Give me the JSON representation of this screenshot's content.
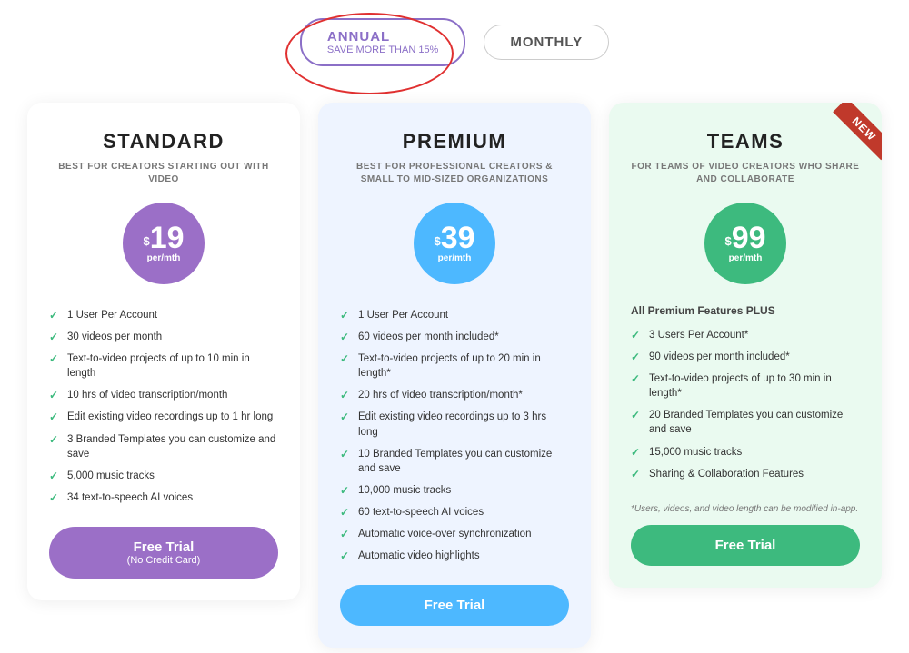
{
  "toggle": {
    "annual_label": "ANNUAL",
    "annual_sub": "SAVE MORE THAN 15%",
    "monthly_label": "MONTHLY"
  },
  "plans": [
    {
      "id": "standard",
      "title": "STANDARD",
      "subtitle": "BEST FOR CREATORS STARTING OUT WITH VIDEO",
      "price_symbol": "$",
      "price": "19",
      "price_unit": "per/mth",
      "circle_class": "purple",
      "features": [
        "1 User Per Account",
        "30 videos per month",
        "Text-to-video projects of up to 10 min in length",
        "10 hrs of video transcription/month",
        "Edit existing video recordings up to 1 hr long",
        "3 Branded Templates you can customize and save",
        "5,000 music tracks",
        "34 text-to-speech AI voices"
      ],
      "cta_label": "Free Trial",
      "cta_sub": "(No Credit Card)",
      "cta_class": "purple-btn",
      "is_new": false,
      "teams_intro": "",
      "teams_note": ""
    },
    {
      "id": "premium",
      "title": "PREMIUM",
      "subtitle": "BEST FOR PROFESSIONAL CREATORS & SMALL TO MID-SIZED ORGANIZATIONS",
      "price_symbol": "$",
      "price": "39",
      "price_unit": "per/mth",
      "circle_class": "blue",
      "features": [
        "1 User Per Account",
        "60 videos per month included*",
        "Text-to-video projects of up to 20 min in length*",
        "20 hrs of video transcription/month*",
        "Edit existing video recordings up to 3 hrs long",
        "10 Branded Templates you can customize and save",
        "10,000 music tracks",
        "60 text-to-speech AI voices",
        "Automatic voice-over synchronization",
        "Automatic video highlights"
      ],
      "cta_label": "Free Trial",
      "cta_sub": "",
      "cta_class": "blue-btn",
      "is_new": false,
      "teams_intro": "",
      "teams_note": ""
    },
    {
      "id": "teams",
      "title": "TEAMS",
      "subtitle": "FOR TEAMS OF VIDEO CREATORS WHO SHARE AND COLLABORATE",
      "price_symbol": "$",
      "price": "99",
      "price_unit": "per/mth",
      "circle_class": "green",
      "features": [
        "3 Users Per Account*",
        "90 videos per month included*",
        "Text-to-video projects of up to 30 min in length*",
        "20 Branded Templates you can customize and save",
        "15,000 music tracks",
        "Sharing & Collaboration Features"
      ],
      "cta_label": "Free Trial",
      "cta_sub": "",
      "cta_class": "green-btn",
      "is_new": true,
      "teams_intro": "All Premium Features PLUS",
      "teams_note": "*Users, videos, and video length can be modified in-app."
    }
  ]
}
